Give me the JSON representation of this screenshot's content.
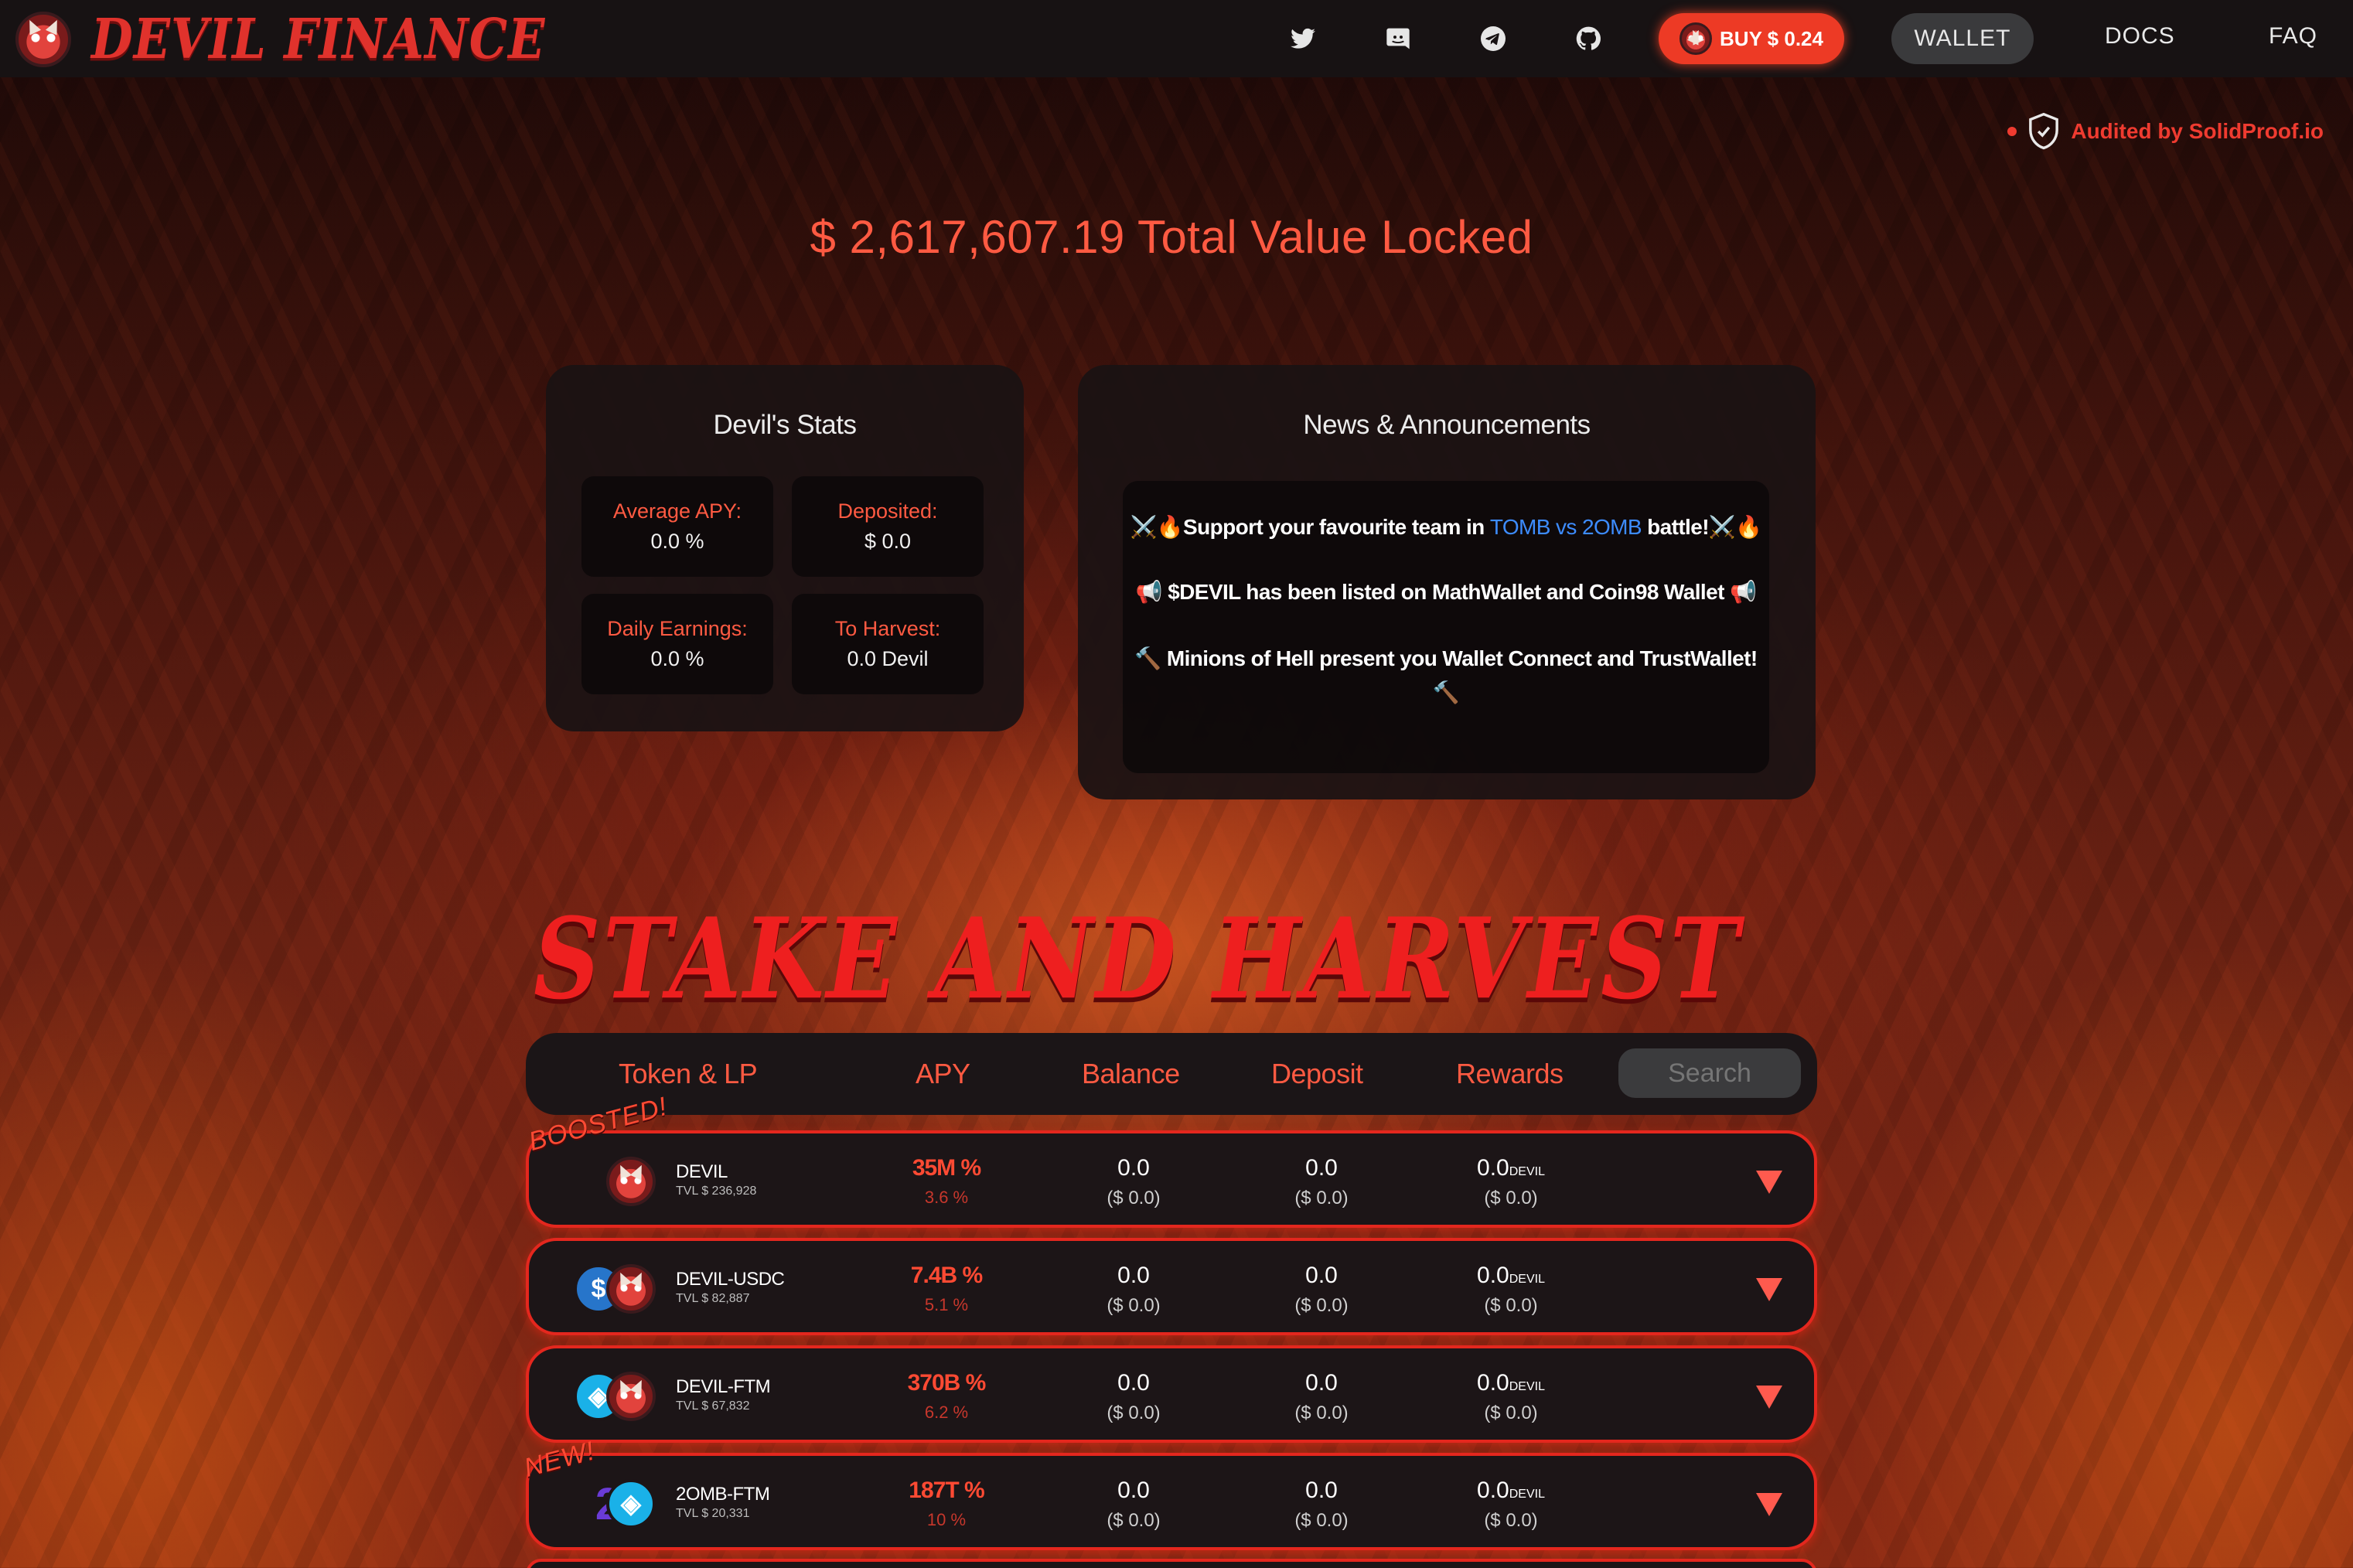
{
  "brand": {
    "name": "DEVIL FINANCE"
  },
  "nav": {
    "icons": [
      "twitter-icon",
      "discord-icon",
      "telegram-icon",
      "github-icon"
    ],
    "buy_label": "BUY $ 0.24",
    "wallet_label": "WALLET",
    "docs_label": "DOCS",
    "faq_label": "FAQ"
  },
  "audit": {
    "label": "Audited by SolidProof.io"
  },
  "tvl": {
    "text": "$ 2,617,607.19 Total Value Locked"
  },
  "stats": {
    "title": "Devil's Stats",
    "items": [
      {
        "label": "Average APY:",
        "value": "0.0 %"
      },
      {
        "label": "Deposited:",
        "value": "$ 0.0"
      },
      {
        "label": "Daily Earnings:",
        "value": "0.0 %"
      },
      {
        "label": "To Harvest:",
        "value": "0.0 Devil"
      }
    ]
  },
  "news": {
    "title": "News & Announcements",
    "items": [
      {
        "pre": "⚔️🔥Support your favourite team in ",
        "highlight": "TOMB vs 2OMB",
        "post": " battle!⚔️🔥"
      },
      {
        "text": "📢 $DEVIL has been listed on MathWallet and Coin98 Wallet 📢"
      },
      {
        "text": "🔨 Minions of Hell present you Wallet Connect and TrustWallet! 🔨"
      }
    ]
  },
  "stake": {
    "title": "STAKE AND HARVEST"
  },
  "table": {
    "headers": {
      "token": "Token & LP",
      "apy": "APY",
      "balance": "Balance",
      "deposit": "Deposit",
      "rewards": "Rewards"
    },
    "search_placeholder": "Search",
    "rows": [
      {
        "badge": "BOOSTED!",
        "name": "DEVIL",
        "tvl": "TVL $ 236,928",
        "apy": "35M %",
        "apy_sub": "3.6 %",
        "balance": "0.0",
        "balance_usd": "($ 0.0)",
        "deposit": "0.0",
        "deposit_usd": "($ 0.0)",
        "rewards": "0.0",
        "rewards_unit": "DEVIL",
        "rewards_usd": "($ 0.0)"
      },
      {
        "badge": "",
        "name": "DEVIL-USDC",
        "tvl": "TVL $ 82,887",
        "apy": "7.4B %",
        "apy_sub": "5.1 %",
        "balance": "0.0",
        "balance_usd": "($ 0.0)",
        "deposit": "0.0",
        "deposit_usd": "($ 0.0)",
        "rewards": "0.0",
        "rewards_unit": "DEVIL",
        "rewards_usd": "($ 0.0)"
      },
      {
        "badge": "",
        "name": "DEVIL-FTM",
        "tvl": "TVL $ 67,832",
        "apy": "370B %",
        "apy_sub": "6.2 %",
        "balance": "0.0",
        "balance_usd": "($ 0.0)",
        "deposit": "0.0",
        "deposit_usd": "($ 0.0)",
        "rewards": "0.0",
        "rewards_unit": "DEVIL",
        "rewards_usd": "($ 0.0)"
      },
      {
        "badge": "NEW!",
        "name": "2OMB-FTM",
        "tvl": "TVL $ 20,331",
        "apy": "187T %",
        "apy_sub": "10 %",
        "balance": "0.0",
        "balance_usd": "($ 0.0)",
        "deposit": "0.0",
        "deposit_usd": "($ 0.0)",
        "rewards": "0.0",
        "rewards_unit": "DEVIL",
        "rewards_usd": "($ 0.0)"
      }
    ]
  },
  "colors": {
    "accent": "#ff5a42",
    "button": "#ed3a25",
    "card": "#1a1213",
    "border": "#e4271e"
  }
}
